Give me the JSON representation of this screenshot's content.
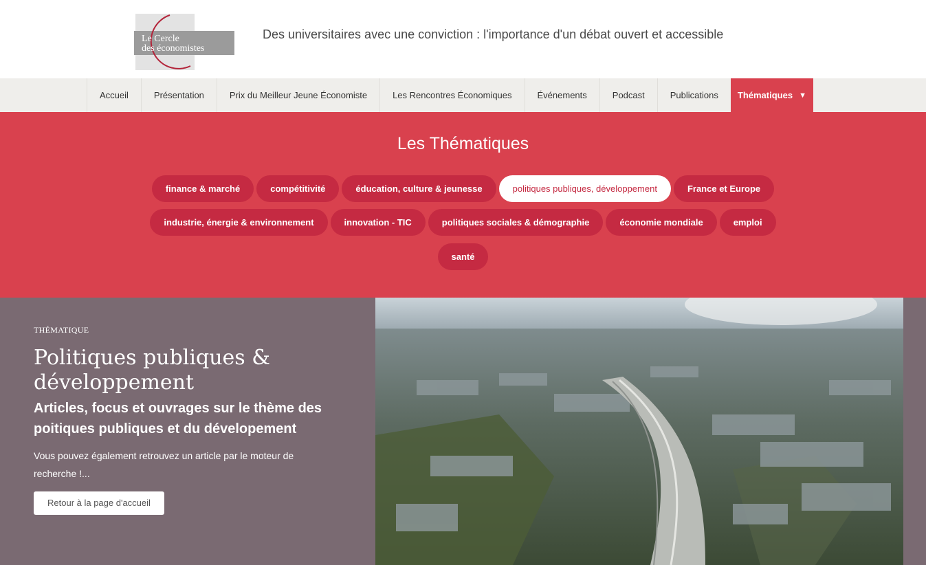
{
  "header": {
    "logo_line1": "Le Cercle",
    "logo_line2": "des économistes",
    "tagline": "Des universitaires avec une conviction : l'importance d'un débat ouvert et accessible"
  },
  "nav": {
    "items": [
      {
        "label": "Accueil"
      },
      {
        "label": "Présentation"
      },
      {
        "label": "Prix du Meilleur Jeune Économiste"
      },
      {
        "label": "Les Rencontres Économiques"
      },
      {
        "label": "Événements"
      },
      {
        "label": "Podcast"
      },
      {
        "label": "Publications"
      },
      {
        "label": "Thématiques",
        "active": true
      }
    ],
    "caret": "▼"
  },
  "thematiques": {
    "title": "Les Thématiques",
    "rows": [
      [
        {
          "label": "finance & marché"
        },
        {
          "label": "compétitivité"
        },
        {
          "label": "éducation, culture & jeunesse"
        },
        {
          "label": "politiques publiques, développement",
          "selected": true
        },
        {
          "label": "France et Europe"
        }
      ],
      [
        {
          "label": "industrie, énergie & environnement"
        },
        {
          "label": "innovation - TIC"
        },
        {
          "label": "politiques sociales & démographie"
        },
        {
          "label": "économie mondiale"
        },
        {
          "label": "emploi"
        }
      ],
      [
        {
          "label": "santé"
        }
      ]
    ]
  },
  "hero": {
    "kicker": "THÉMATIQUE",
    "title": "Politiques publiques & développement",
    "subtitle": "Articles, focus et ouvrages sur le thème des poitiques publiques et du dévelopement",
    "description": "Vous pouvez également retrouvez un article par le moteur de recherche !...",
    "button": "Retour à la page d'accueil"
  },
  "colors": {
    "brand_red": "#d9414e",
    "pill_red": "#c52a42",
    "hero_bg": "#7a6a72",
    "nav_bg": "#efeeeb"
  }
}
